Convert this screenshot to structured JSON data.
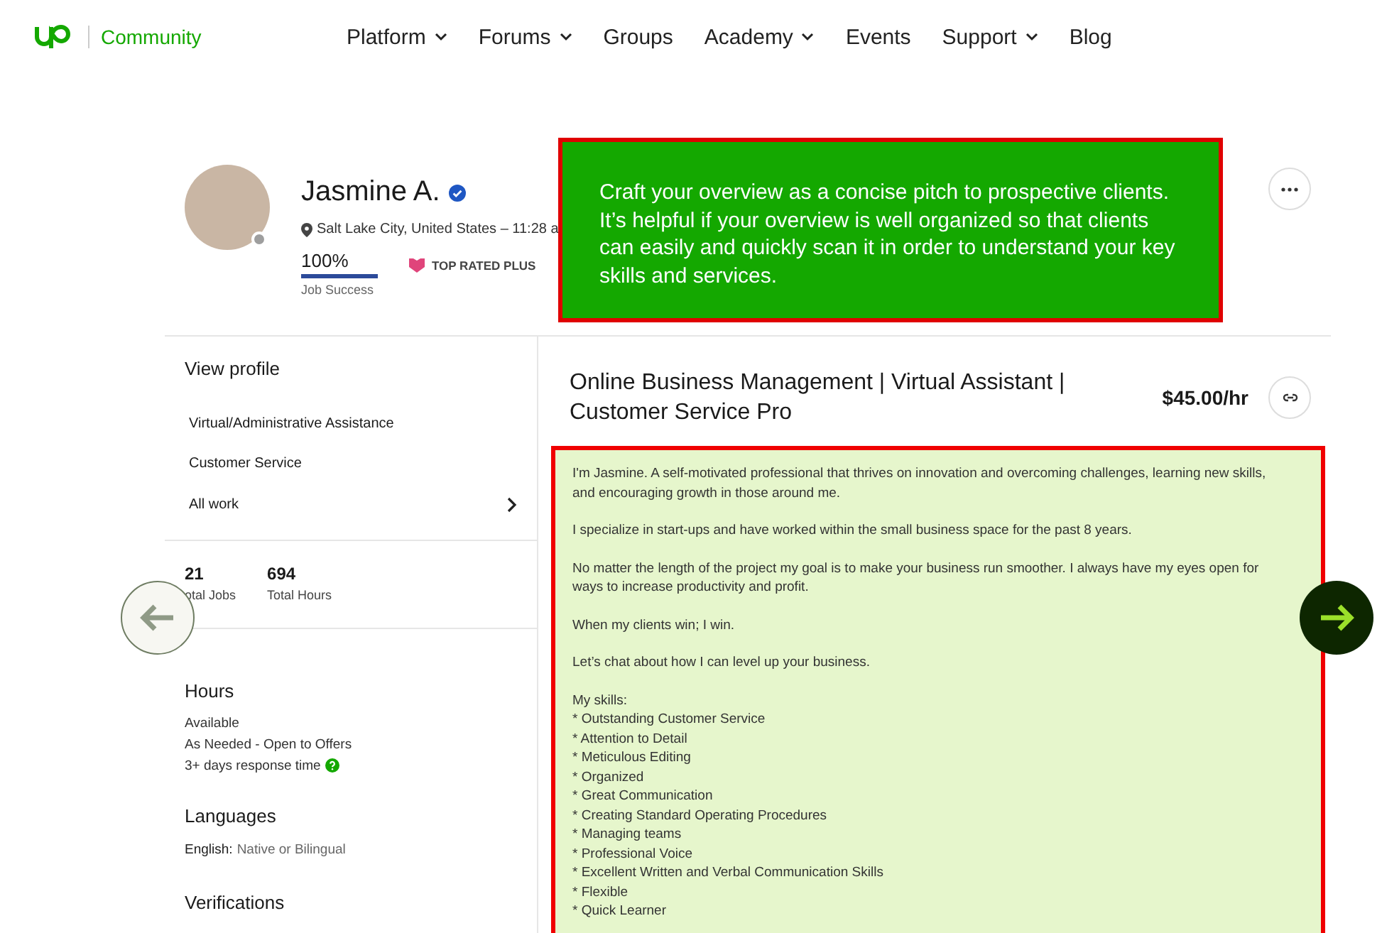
{
  "header": {
    "brand": "Community",
    "nav": [
      {
        "label": "Platform",
        "dropdown": true
      },
      {
        "label": "Forums",
        "dropdown": true
      },
      {
        "label": "Groups",
        "dropdown": false
      },
      {
        "label": "Academy",
        "dropdown": true
      },
      {
        "label": "Events",
        "dropdown": false
      },
      {
        "label": "Support",
        "dropdown": true
      },
      {
        "label": "Blog",
        "dropdown": false
      }
    ]
  },
  "profile": {
    "name": "Jasmine A.",
    "verified": true,
    "online": false,
    "location": "Salt Lake City, United States – 11:28 a",
    "job_success": {
      "value": "100%",
      "label": "Job Success",
      "level": 1
    },
    "badge": "TOP RATED PLUS"
  },
  "callout": "Craft your overview as a concise pitch to prospective clients. It’s helpful if your overview is well organized so that clients can easily and quickly scan it in order to understand your key skills and services.",
  "sidebar": {
    "heading": "View profile",
    "items": [
      {
        "label": "Virtual/Administrative Assistance",
        "chevron": false
      },
      {
        "label": "Customer Service",
        "chevron": false
      },
      {
        "label": "All work",
        "chevron": true
      }
    ],
    "stats": [
      {
        "value": "21",
        "label": "otal Jobs"
      },
      {
        "value": "694",
        "label": "Total Hours"
      }
    ],
    "hours": {
      "heading": "Hours",
      "lines": [
        "Available",
        "As Needed - Open to Offers",
        "3+ days response time"
      ]
    },
    "languages": {
      "heading": "Languages",
      "entries": [
        {
          "language": "English:",
          "level": "Native or Bilingual"
        }
      ]
    },
    "verifications": {
      "heading": "Verifications"
    }
  },
  "job": {
    "title": "Online Business Management | Virtual Assistant | Customer Service Pro",
    "rate": "$45.00/hr"
  },
  "overview": {
    "paragraphs": [
      "I'm Jasmine. A self-motivated professional that thrives on innovation and overcoming challenges, learning new skills, and encouraging growth in those around me.",
      "I specialize in start-ups and have worked within the small business space for the past 8 years.",
      "No matter the length of the project my goal is to make your business run smoother. I always have my eyes open for ways to increase productivity and profit.",
      "When my clients win; I win.",
      "Let’s chat about how I can level up your business."
    ],
    "skills_heading": "My skills:",
    "skills": [
      "* Outstanding Customer Service",
      "* Attention to Detail",
      "* Meticulous Editing",
      "* Organized",
      "* Great Communication",
      "* Creating Standard Operating Procedures",
      "* Managing teams",
      "* Professional Voice",
      "* Excellent Written and Verbal Communication Skills",
      "* Flexible",
      "* Quick Learner"
    ]
  }
}
